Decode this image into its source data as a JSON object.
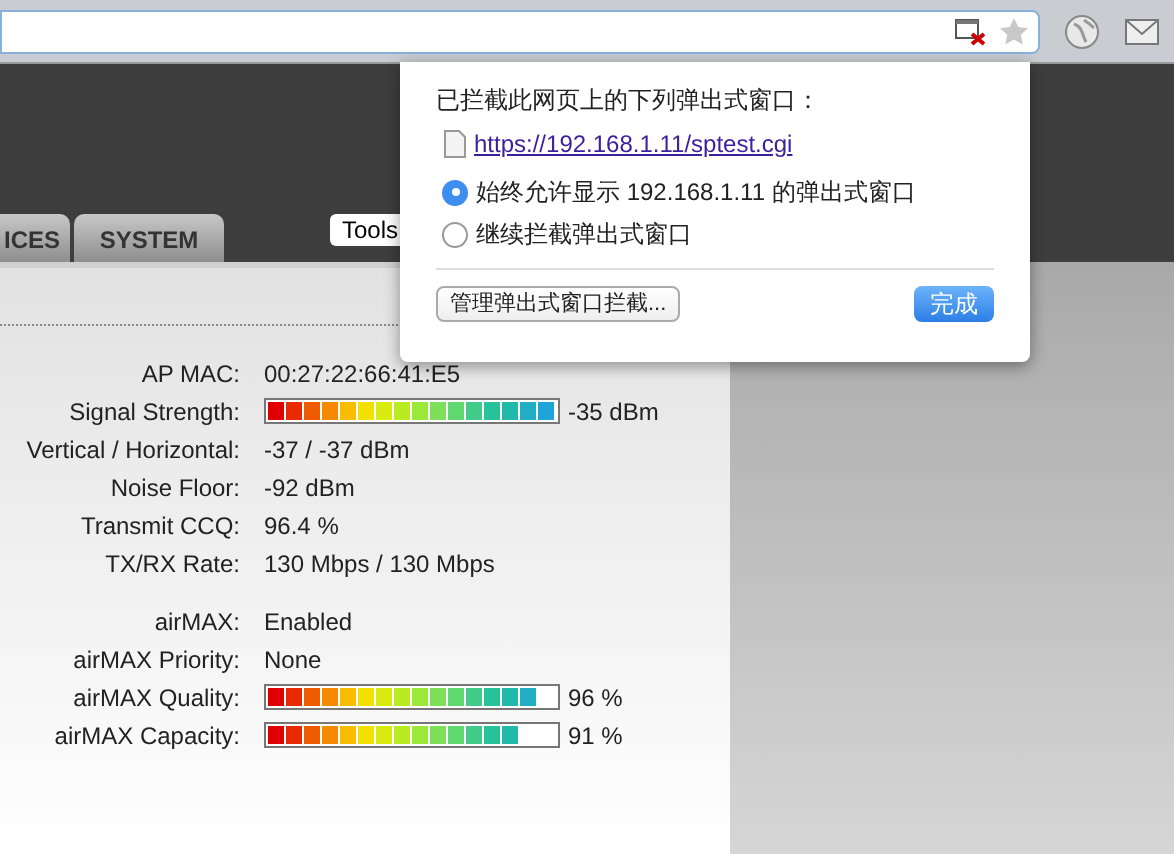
{
  "tabs": [
    {
      "label": "ICES",
      "selected": false
    },
    {
      "label": "SYSTEM",
      "selected": false
    }
  ],
  "tools_dropdown": {
    "label": "Tools"
  },
  "status_rows": [
    {
      "kind": "text",
      "label": "AP MAC:",
      "value": "00:27:22:66:41:E5"
    },
    {
      "kind": "meter",
      "label": "Signal Strength:",
      "level": 1.0,
      "reading": "-35 dBm"
    },
    {
      "kind": "text",
      "label": "Vertical / Horizontal:",
      "value": "-37 / -37 dBm"
    },
    {
      "kind": "text",
      "label": "Noise Floor:",
      "value": "-92 dBm"
    },
    {
      "kind": "text",
      "label": "Transmit CCQ:",
      "value": "96.4 %"
    },
    {
      "kind": "text",
      "label": "TX/RX Rate:",
      "value": "130 Mbps / 130 Mbps"
    },
    {
      "kind": "gap"
    },
    {
      "kind": "text",
      "label": "airMAX:",
      "value": "Enabled"
    },
    {
      "kind": "text",
      "label": "airMAX Priority:",
      "value": "None"
    },
    {
      "kind": "meter",
      "label": "airMAX Quality:",
      "level": 0.96,
      "reading": "96 %"
    },
    {
      "kind": "meter",
      "label": "airMAX Capacity:",
      "level": 0.91,
      "reading": "91 %"
    }
  ],
  "popup": {
    "heading": "已拦截此网页上的下列弹出式窗口：",
    "link": "https://192.168.1.11/sptest.cgi",
    "options": [
      {
        "label": "始终允许显示 192.168.1.11 的弹出式窗口",
        "selected": true
      },
      {
        "label": "继续拦截弹出式窗口",
        "selected": false
      }
    ],
    "manage_button": "管理弹出式窗口拦截...",
    "done_button": "完成"
  }
}
